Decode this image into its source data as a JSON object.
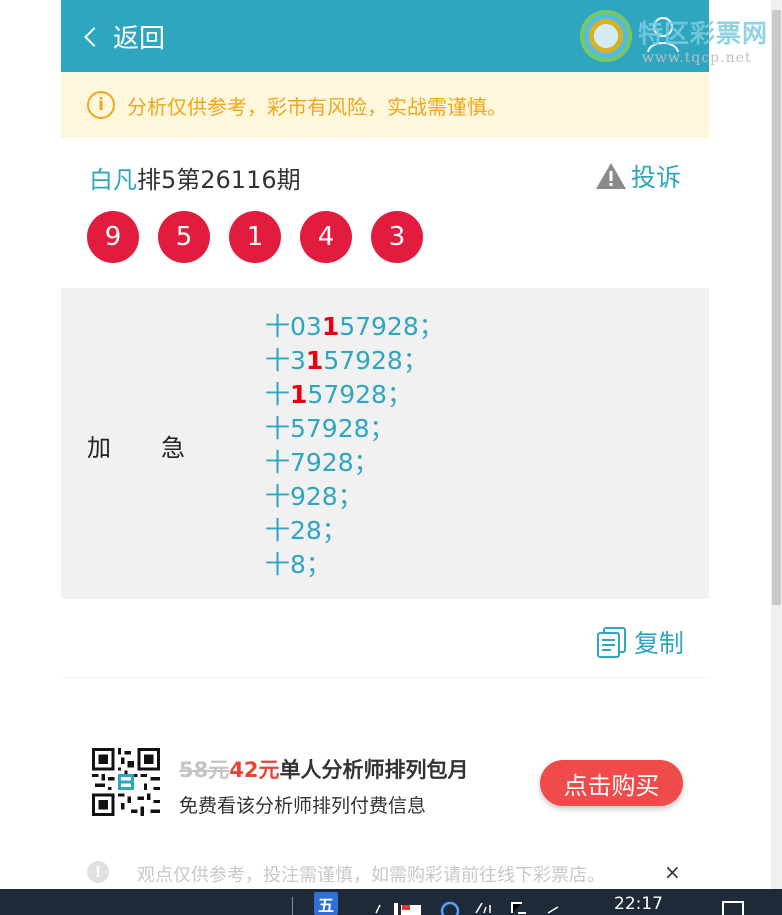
{
  "header": {
    "back_label": "返回",
    "watermark_title": "特区彩票网",
    "watermark_url": "www.tqcp.net"
  },
  "notice": {
    "text": "分析仅供参考，彩市有风险，实战需谨慎。"
  },
  "title": {
    "author": "白凡",
    "issue": "排5第26116期"
  },
  "complain_label": "投诉",
  "balls": [
    "9",
    "5",
    "1",
    "4",
    "3"
  ],
  "content": {
    "label_chars": [
      "加",
      "急"
    ],
    "lines": [
      {
        "prefix": "十03",
        "hl": "1",
        "suffix": "57928；"
      },
      {
        "prefix": "十3",
        "hl": "1",
        "suffix": "57928；"
      },
      {
        "prefix": "十",
        "hl": "1",
        "suffix": "57928；"
      },
      {
        "prefix": "十57928；",
        "hl": "",
        "suffix": ""
      },
      {
        "prefix": "十7928；",
        "hl": "",
        "suffix": ""
      },
      {
        "prefix": "十928；",
        "hl": "",
        "suffix": ""
      },
      {
        "prefix": "十28；",
        "hl": "",
        "suffix": ""
      },
      {
        "prefix": "十8；",
        "hl": "",
        "suffix": ""
      }
    ]
  },
  "copy_label": "复制",
  "promo": {
    "old_price": "58元",
    "new_price": "42元",
    "title": "单人分析师排列包月",
    "subtitle": "免费看该分析师排列付费信息",
    "buy_label": "点击购买"
  },
  "bottom_notice": {
    "text": "观点仅供参考，投注需谨慎，如需购彩请前往线下彩票店。",
    "close": "×"
  },
  "taskbar": {
    "ime": "五",
    "clock": "22:17"
  },
  "colors": {
    "accent": "#2fa6bf",
    "ball": "#e11c3f",
    "highlight": "#e60012",
    "notice_text": "#f2a61c",
    "buy": "#f04a4a"
  }
}
